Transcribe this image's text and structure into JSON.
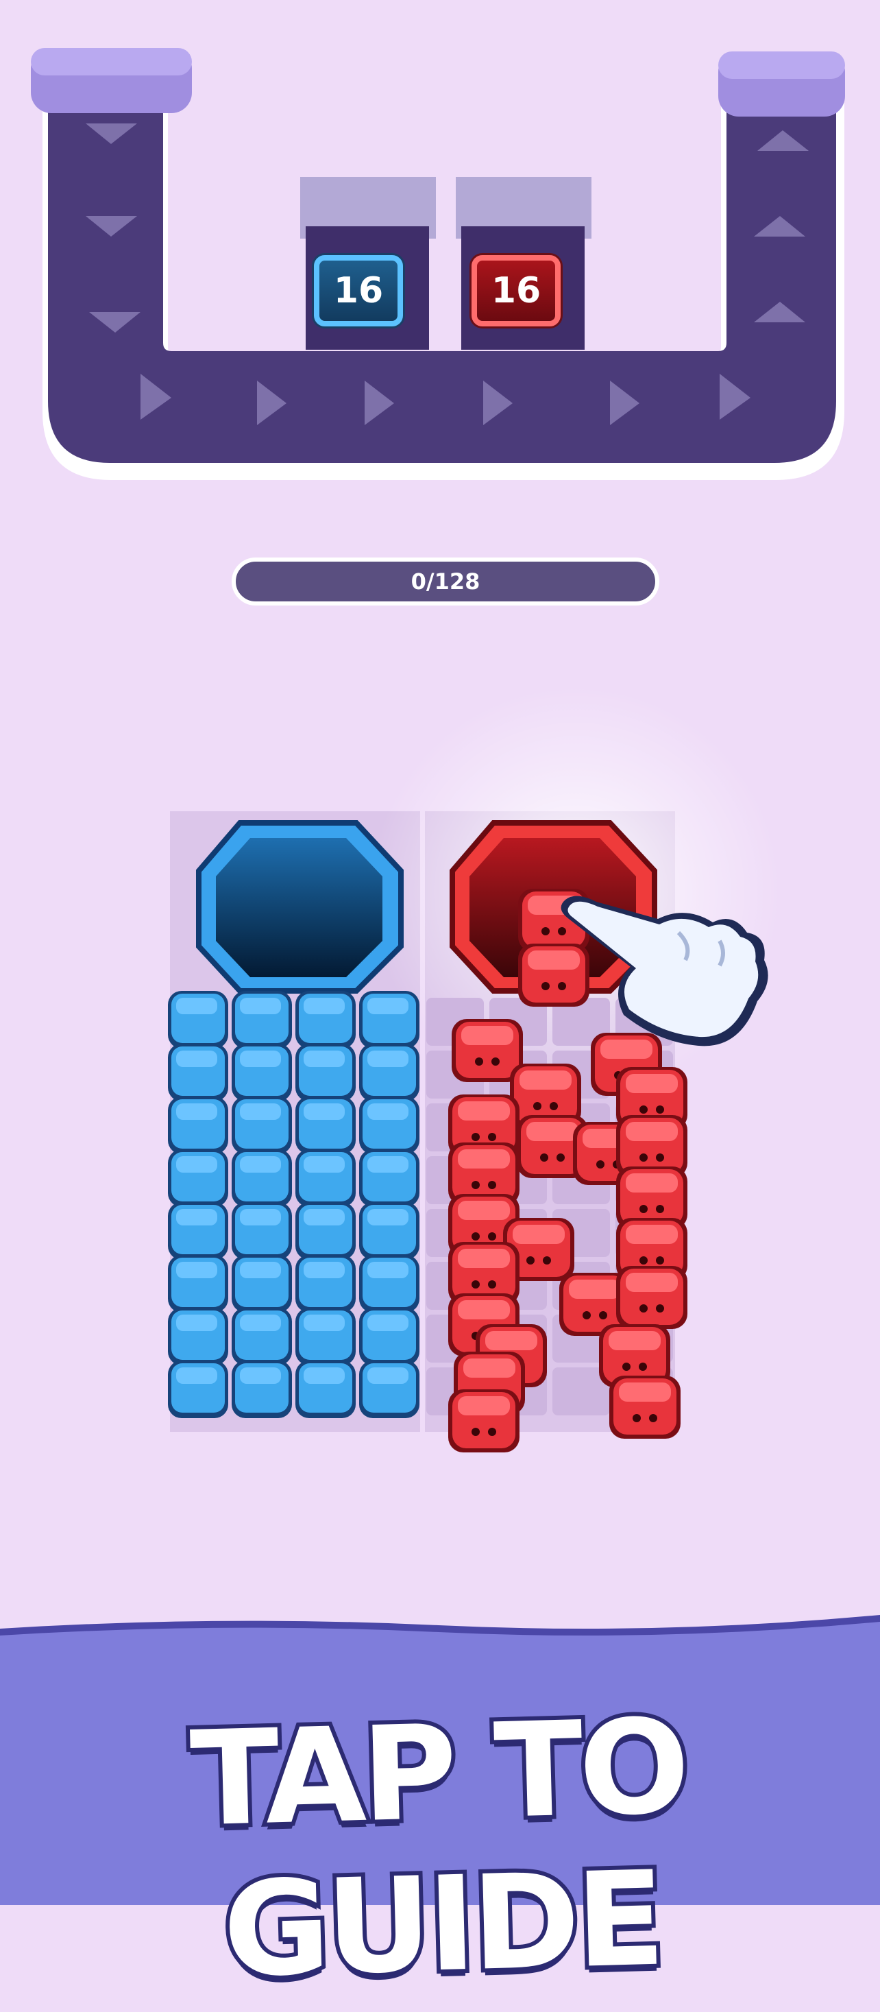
{
  "conveyor": {
    "counters": [
      {
        "color": "#2a8fd6",
        "value": "16"
      },
      {
        "color": "#d62a2a",
        "value": "16"
      }
    ]
  },
  "progress": {
    "current": 0,
    "total": 128,
    "label": "0/128"
  },
  "board": {
    "holes": [
      {
        "color": "blue",
        "name": "blue-hole"
      },
      {
        "color": "red",
        "name": "red-hole"
      }
    ],
    "blue_blocks": {
      "rows": 8,
      "cols": 4,
      "color": "#3fa9ee"
    },
    "red_creatures_color": "#e8343c"
  },
  "banner": {
    "text": "TAP TO GUIDE"
  },
  "colors": {
    "background": "#efdcf8",
    "track": "#4a3a78",
    "banner": "#7d7ad6"
  },
  "icons": [
    "hand-pointer-icon",
    "arrow-icon"
  ]
}
